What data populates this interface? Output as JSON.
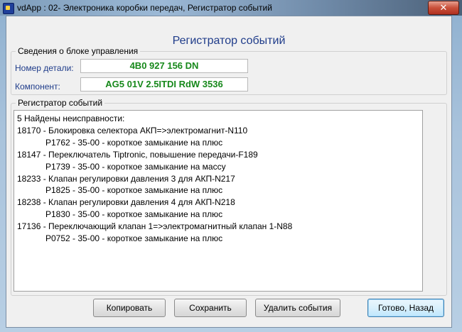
{
  "window": {
    "title": "vdApp : 02- Электроника коробки передач,  Регистратор событий",
    "close_glyph": "✕"
  },
  "dialog": {
    "heading": "Регистратор событий"
  },
  "control_unit": {
    "group_label": "Сведения о блоке управления",
    "part_number_label": "Номер детали:",
    "part_number": "4B0 927 156 DN",
    "component_label": "Компонент:",
    "component": "AG5 01V 2.5ITDI RdW 3536"
  },
  "event_log": {
    "group_label": "Регистратор событий",
    "lines": [
      "5 Найдены неисправности:",
      "18170 - Блокировка селектора АКП=>электромагнит-N110",
      "            P1762 - 35-00 - короткое замыкание на плюс",
      "18147 - Переключатель Tiptronic, повышение передачи-F189",
      "            P1739 - 35-00 - короткое замыкание на массу",
      "18233 - Клапан регулировки давления 3 для АКП-N217",
      "            P1825 - 35-00 - короткое замыкание на плюс",
      "18238 - Клапан регулировки давления 4 для АКП-N218",
      "            P1830 - 35-00 - короткое замыкание на плюс",
      "17136 - Переключающий клапан 1=>электромагнитный клапан 1-N88",
      "            P0752 - 35-00 - короткое замыкание на плюс"
    ]
  },
  "buttons": {
    "copy": "Копировать",
    "save": "Сохранить",
    "delete": "Удалить события",
    "done": "Готово, Назад"
  },
  "colors": {
    "heading": "#1f3c8a",
    "value_text": "#16881a"
  }
}
